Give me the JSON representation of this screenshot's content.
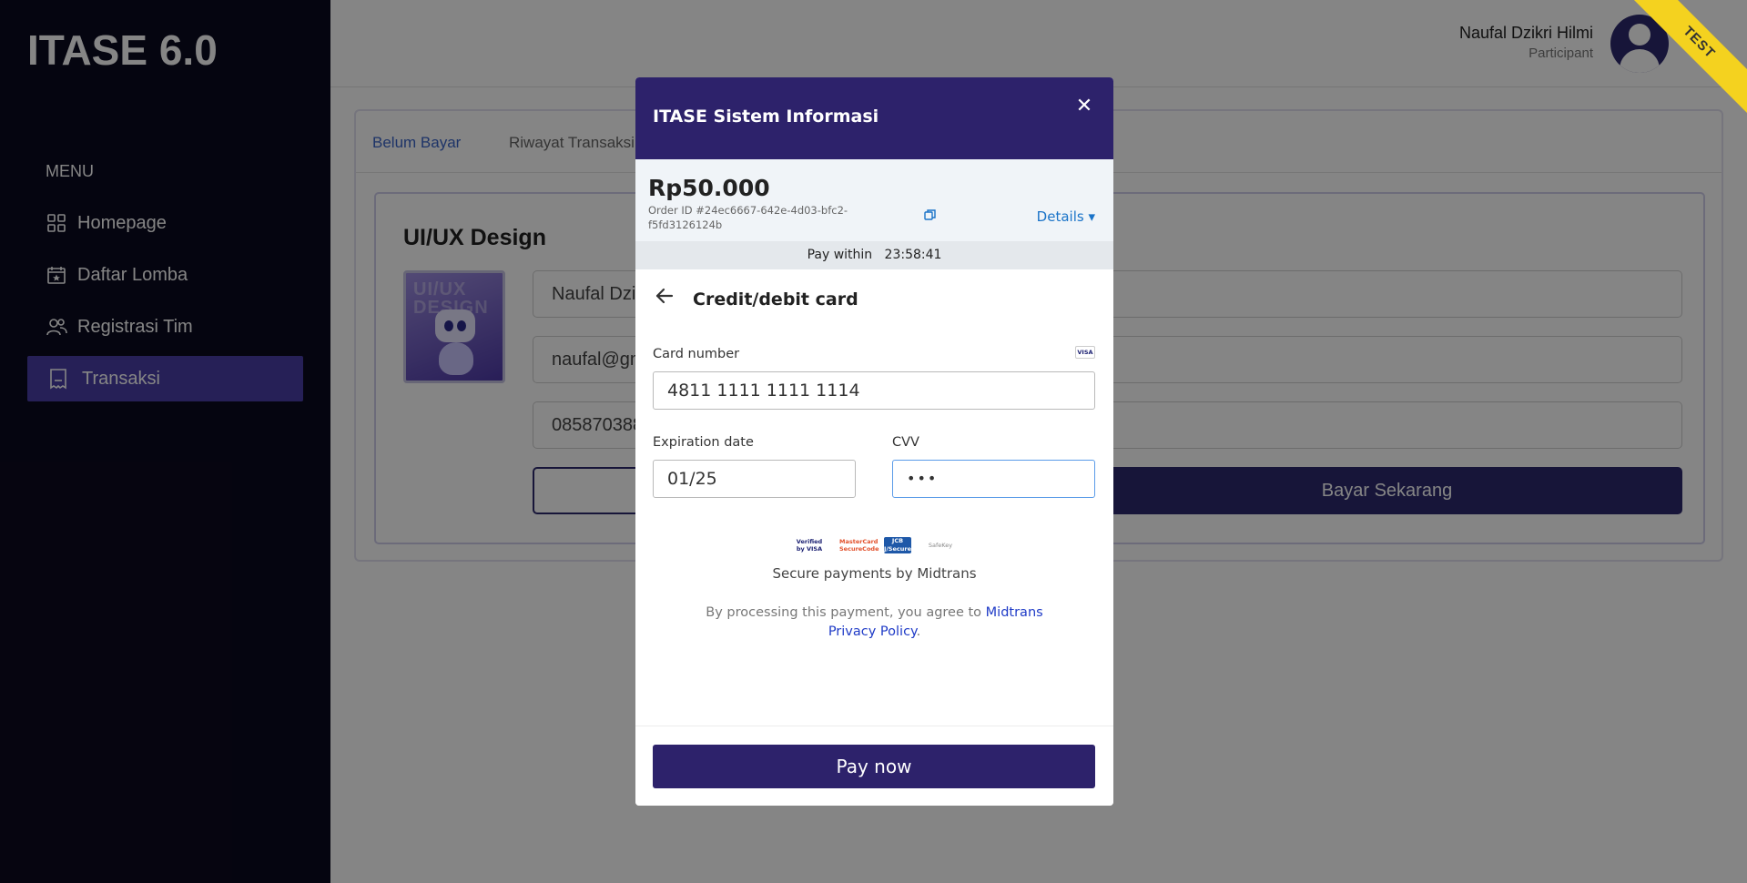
{
  "app": {
    "title": "ITASE 6.0"
  },
  "sidebar": {
    "menu_label": "MENU",
    "items": [
      {
        "label": "Homepage",
        "icon": "grid-icon"
      },
      {
        "label": "Daftar Lomba",
        "icon": "calendar-star-icon"
      },
      {
        "label": "Registrasi Tim",
        "icon": "users-icon"
      },
      {
        "label": "Transaksi",
        "icon": "receipt-icon",
        "active": true
      }
    ]
  },
  "header": {
    "user_name": "Naufal Dzikri Hilmi",
    "user_role": "Participant",
    "ribbon": "TEST"
  },
  "main": {
    "tabs": [
      {
        "label": "Belum Bayar"
      },
      {
        "label": "Riwayat Transaksi"
      }
    ],
    "card": {
      "title": "UI/UX Design",
      "thumbnail_text": "UI/UX DESIGN",
      "fields": [
        "Naufal Dzikri Hilmi",
        "naufal@gmail.com",
        "085870388"
      ],
      "pay_button": "Bayar Sekarang"
    }
  },
  "modal": {
    "title": "ITASE Sistem Informasi",
    "close_icon": "close-icon",
    "amount": "Rp50.000",
    "order_id": "Order ID #24ec6667-642e-4d03-bfc2-f5fd3126124b",
    "details_label": "Details",
    "pay_within_label": "Pay within",
    "pay_within_time": "23:58:41",
    "section_title": "Credit/debit card",
    "card_number_label": "Card number",
    "card_number_value": "4811 1111 1111 1114",
    "card_brand": "VISA",
    "expiration_label": "Expiration date",
    "expiration_value": "01/25",
    "cvv_label": "CVV",
    "cvv_value": "•••",
    "security_logos": [
      "Verified by VISA",
      "MasterCard SecureCode",
      "JCB J/Secure",
      "SafeKey"
    ],
    "secure_text": "Secure payments by Midtrans",
    "agree_text": "By processing this payment, you agree to ",
    "agree_link": "Midtrans Privacy Policy",
    "agree_end": ".",
    "pay_now": "Pay now"
  },
  "colors": {
    "sidebar_bg": "#0b0a1f",
    "active_nav": "#4a3fa8",
    "modal_header": "#2d226b",
    "link": "#1f3bc7",
    "ribbon": "#f4d21f"
  }
}
